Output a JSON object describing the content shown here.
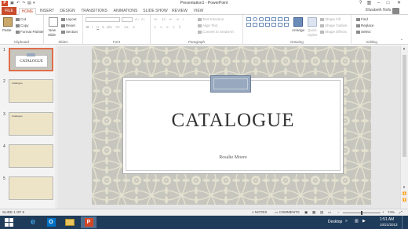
{
  "window": {
    "title": "Presentation1 - PowerPoint",
    "app_logo": "P",
    "help": "?",
    "controls": [
      "ribbon-display-icon",
      "minimize-icon",
      "restore-icon",
      "close-icon"
    ]
  },
  "tabs": [
    "FILE",
    "HOME",
    "INSERT",
    "DESIGN",
    "TRANSITIONS",
    "ANIMATIONS",
    "SLIDE SHOW",
    "REVIEW",
    "VIEW"
  ],
  "active_tab": "HOME",
  "user": {
    "name": "Elizabeth Nofs"
  },
  "ribbon": {
    "clipboard": {
      "paste": "Paste",
      "cut": "Cut",
      "copy": "Copy",
      "format_painter": "Format Painter",
      "label": "Clipboard"
    },
    "slides": {
      "new_slide": "New",
      "new_slide2": "Slide",
      "layout": "Layout",
      "reset": "Reset",
      "section": "Section",
      "label": "Slides"
    },
    "font": {
      "bold": "B",
      "italic": "I",
      "underline": "U",
      "strike": "S",
      "shadow": "abc",
      "spacing": "AV",
      "case": "Aa",
      "color": "A",
      "label": "Font"
    },
    "paragraph": {
      "text_direction": "Text Direction",
      "align_text": "Align Text",
      "convert_smartart": "Convert to SmartArt",
      "label": "Paragraph"
    },
    "drawing": {
      "arrange": "Arrange",
      "quick_styles": "Quick",
      "quick_styles2": "Styles",
      "shape_fill": "Shape Fill",
      "shape_outline": "Shape Outline",
      "shape_effects": "Shape Effects",
      "label": "Drawing"
    },
    "editing": {
      "find": "Find",
      "replace": "Replace",
      "select": "Select",
      "label": "Editing"
    }
  },
  "slides": [
    {
      "number": "1",
      "title": "CATALOGUE",
      "selected": true
    },
    {
      "number": "2",
      "title": "Catalogue"
    },
    {
      "number": "3",
      "title": "Catalogue"
    },
    {
      "number": "4",
      "title": ""
    },
    {
      "number": "5",
      "title": ""
    }
  ],
  "current_slide": {
    "title": "CATALOGUE",
    "subtitle": "Rosalie Moore"
  },
  "status": {
    "slide_counter": "SLIDE 1 OF 5",
    "notes": "NOTES",
    "comments": "COMMENTS",
    "zoom": "74%"
  },
  "taskbar": {
    "desktop": "Desktop",
    "time": "1:51 AM",
    "date": "10/21/2013"
  }
}
